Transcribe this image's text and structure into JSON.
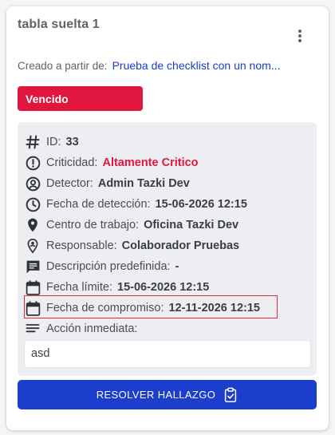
{
  "card": {
    "title": "tabla suelta 1",
    "origin_label": "Creado a partir de:",
    "origin_link": "Prueba de checklist con un nom...",
    "status": "Vencido"
  },
  "details": {
    "id": {
      "label": "ID:",
      "value": "33"
    },
    "criticality": {
      "label": "Criticidad:",
      "value": "Altamente Critico"
    },
    "detector": {
      "label": "Detector:",
      "value": "Admin Tazki Dev"
    },
    "detection_date": {
      "label": "Fecha de detección:",
      "value": "15-06-2026 12:15"
    },
    "work_center": {
      "label": "Centro de trabajo:",
      "value": "Oficina Tazki Dev"
    },
    "responsible": {
      "label": "Responsable:",
      "value": "Colaborador Pruebas"
    },
    "predefined_description": {
      "label": "Descripción predefinida:",
      "value": "-"
    },
    "deadline": {
      "label": "Fecha límite:",
      "value": "15-06-2026 12:15"
    },
    "commitment_date": {
      "label": "Fecha de compromiso:",
      "value": "12-11-2026 12:15"
    },
    "immediate_action": {
      "label": "Acción inmediata:",
      "value": "asd"
    }
  },
  "actions": {
    "resolve_label": "RESOLVER HALLAZGO"
  },
  "icons": {
    "id": "hash-icon",
    "criticality": "alert-circle-icon",
    "detector": "user-circle-icon",
    "detection_date": "clock-icon",
    "work_center": "location-pin-icon",
    "responsible": "person-pin-icon",
    "description": "comment-icon",
    "deadline": "calendar-icon",
    "commitment": "calendar-icon",
    "action": "notes-icon",
    "resolve": "clipboard-check-icon"
  },
  "colors": {
    "status_red": "#e0163f",
    "primary_blue": "#1c3ecd",
    "link_blue": "#1a40c7",
    "highlight_border": "#d9313d"
  }
}
